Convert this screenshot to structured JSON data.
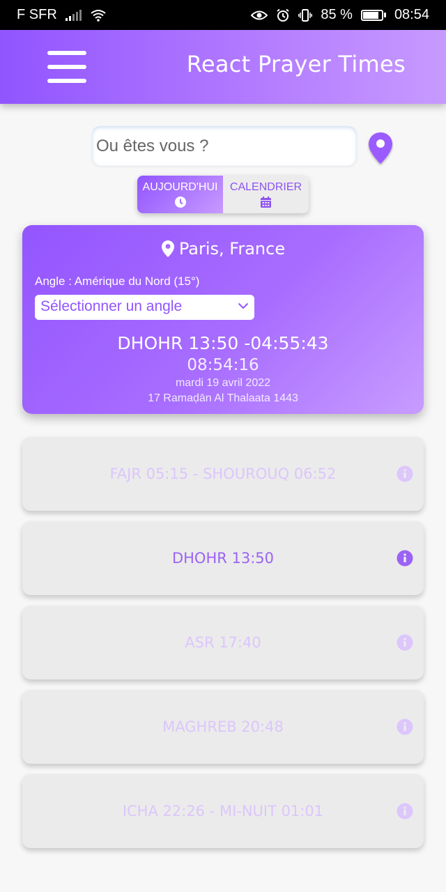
{
  "statusbar": {
    "carrier": "F SFR",
    "battery_pct": "85 %",
    "time": "08:54",
    "icons": [
      "signal-icon",
      "wifi-icon",
      "eye-icon",
      "alarm-icon",
      "vibrate-icon",
      "battery-icon"
    ]
  },
  "header": {
    "title": "React Prayer Times",
    "menu_icon": "hamburger-menu-icon"
  },
  "search": {
    "placeholder": "Ou êtes vous ?",
    "location_icon": "map-pin-icon"
  },
  "tabs": [
    {
      "label": "AUJOURD'HUI",
      "icon": "clock-icon",
      "active": true
    },
    {
      "label": "CALENDRIER",
      "icon": "calendar-icon",
      "active": false
    }
  ],
  "card": {
    "city": "Paris, France",
    "angle_label": "Angle : Amérique du Nord (15°)",
    "angle_select": "Sélectionner un angle",
    "next_prayer": "DHOHR 13:50 -04:55:43",
    "clock": "08:54:16",
    "date": "mardi 19 avril 2022",
    "hijri": "17 Ramaḍān Al Thalaata 1443"
  },
  "prayers": [
    {
      "label": "FAJR 05:15 - SHOUROUQ 06:52",
      "current": false
    },
    {
      "label": "DHOHR 13:50",
      "current": true
    },
    {
      "label": "ASR 17:40",
      "current": false
    },
    {
      "label": "MAGHREB 20:48",
      "current": false
    },
    {
      "label": "ICHA 22:26 - MI-NUIT 01:01",
      "current": false
    }
  ],
  "colors": {
    "accent": "#9155ff",
    "accent_light": "#c79aff",
    "inactive_text": "#dcc6fb",
    "card_bg": "#ebebeb"
  }
}
